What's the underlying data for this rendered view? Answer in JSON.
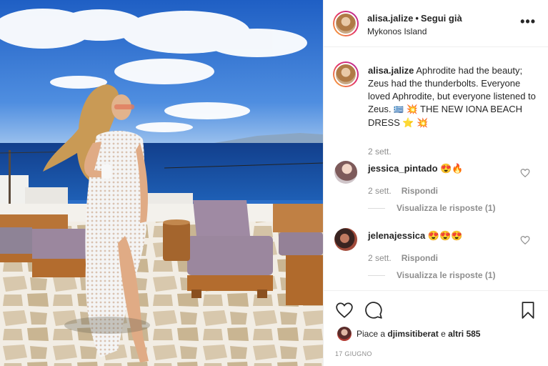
{
  "post": {
    "username": "alisa.jalize",
    "follow_status": "Segui già",
    "location": "Mykonos Island",
    "more_label": "•••"
  },
  "caption": {
    "username": "alisa.jalize",
    "text": "Aphrodite had the beauty; Zeus had the thunderbolts. Everyone loved Aphrodite, but everyone listened to Zeus.",
    "flag": "🇬🇷",
    "sparkle": "💥",
    "tagline": "THE NEW IONA BEACH DRESS",
    "star": "⭐",
    "sparkle2": "💥",
    "time": "2 sett."
  },
  "comments": [
    {
      "username": "jessica_pintado",
      "text": "😍🔥",
      "time": "2 sett.",
      "reply_label": "Rispondi",
      "view_replies": "Visualizza le risposte (1)"
    },
    {
      "username": "jelenajessica",
      "text": "😍😍😍",
      "time": "2 sett.",
      "reply_label": "Rispondi",
      "view_replies": "Visualizza le risposte (1)"
    }
  ],
  "likes": {
    "prefix": "Piace a",
    "user": "djimsitiberat",
    "suffix": "e",
    "others": "altri 585"
  },
  "date": "17 GIUGNO",
  "icons": {
    "like": "heart-outline-icon",
    "comment": "comment-bubble-icon",
    "save": "bookmark-icon",
    "comment_like": "heart-outline-icon"
  },
  "colors": {
    "text": "#262626",
    "muted": "#8e8e8e",
    "sky": "#2a6ec8",
    "sea": "#1a4f9c"
  }
}
